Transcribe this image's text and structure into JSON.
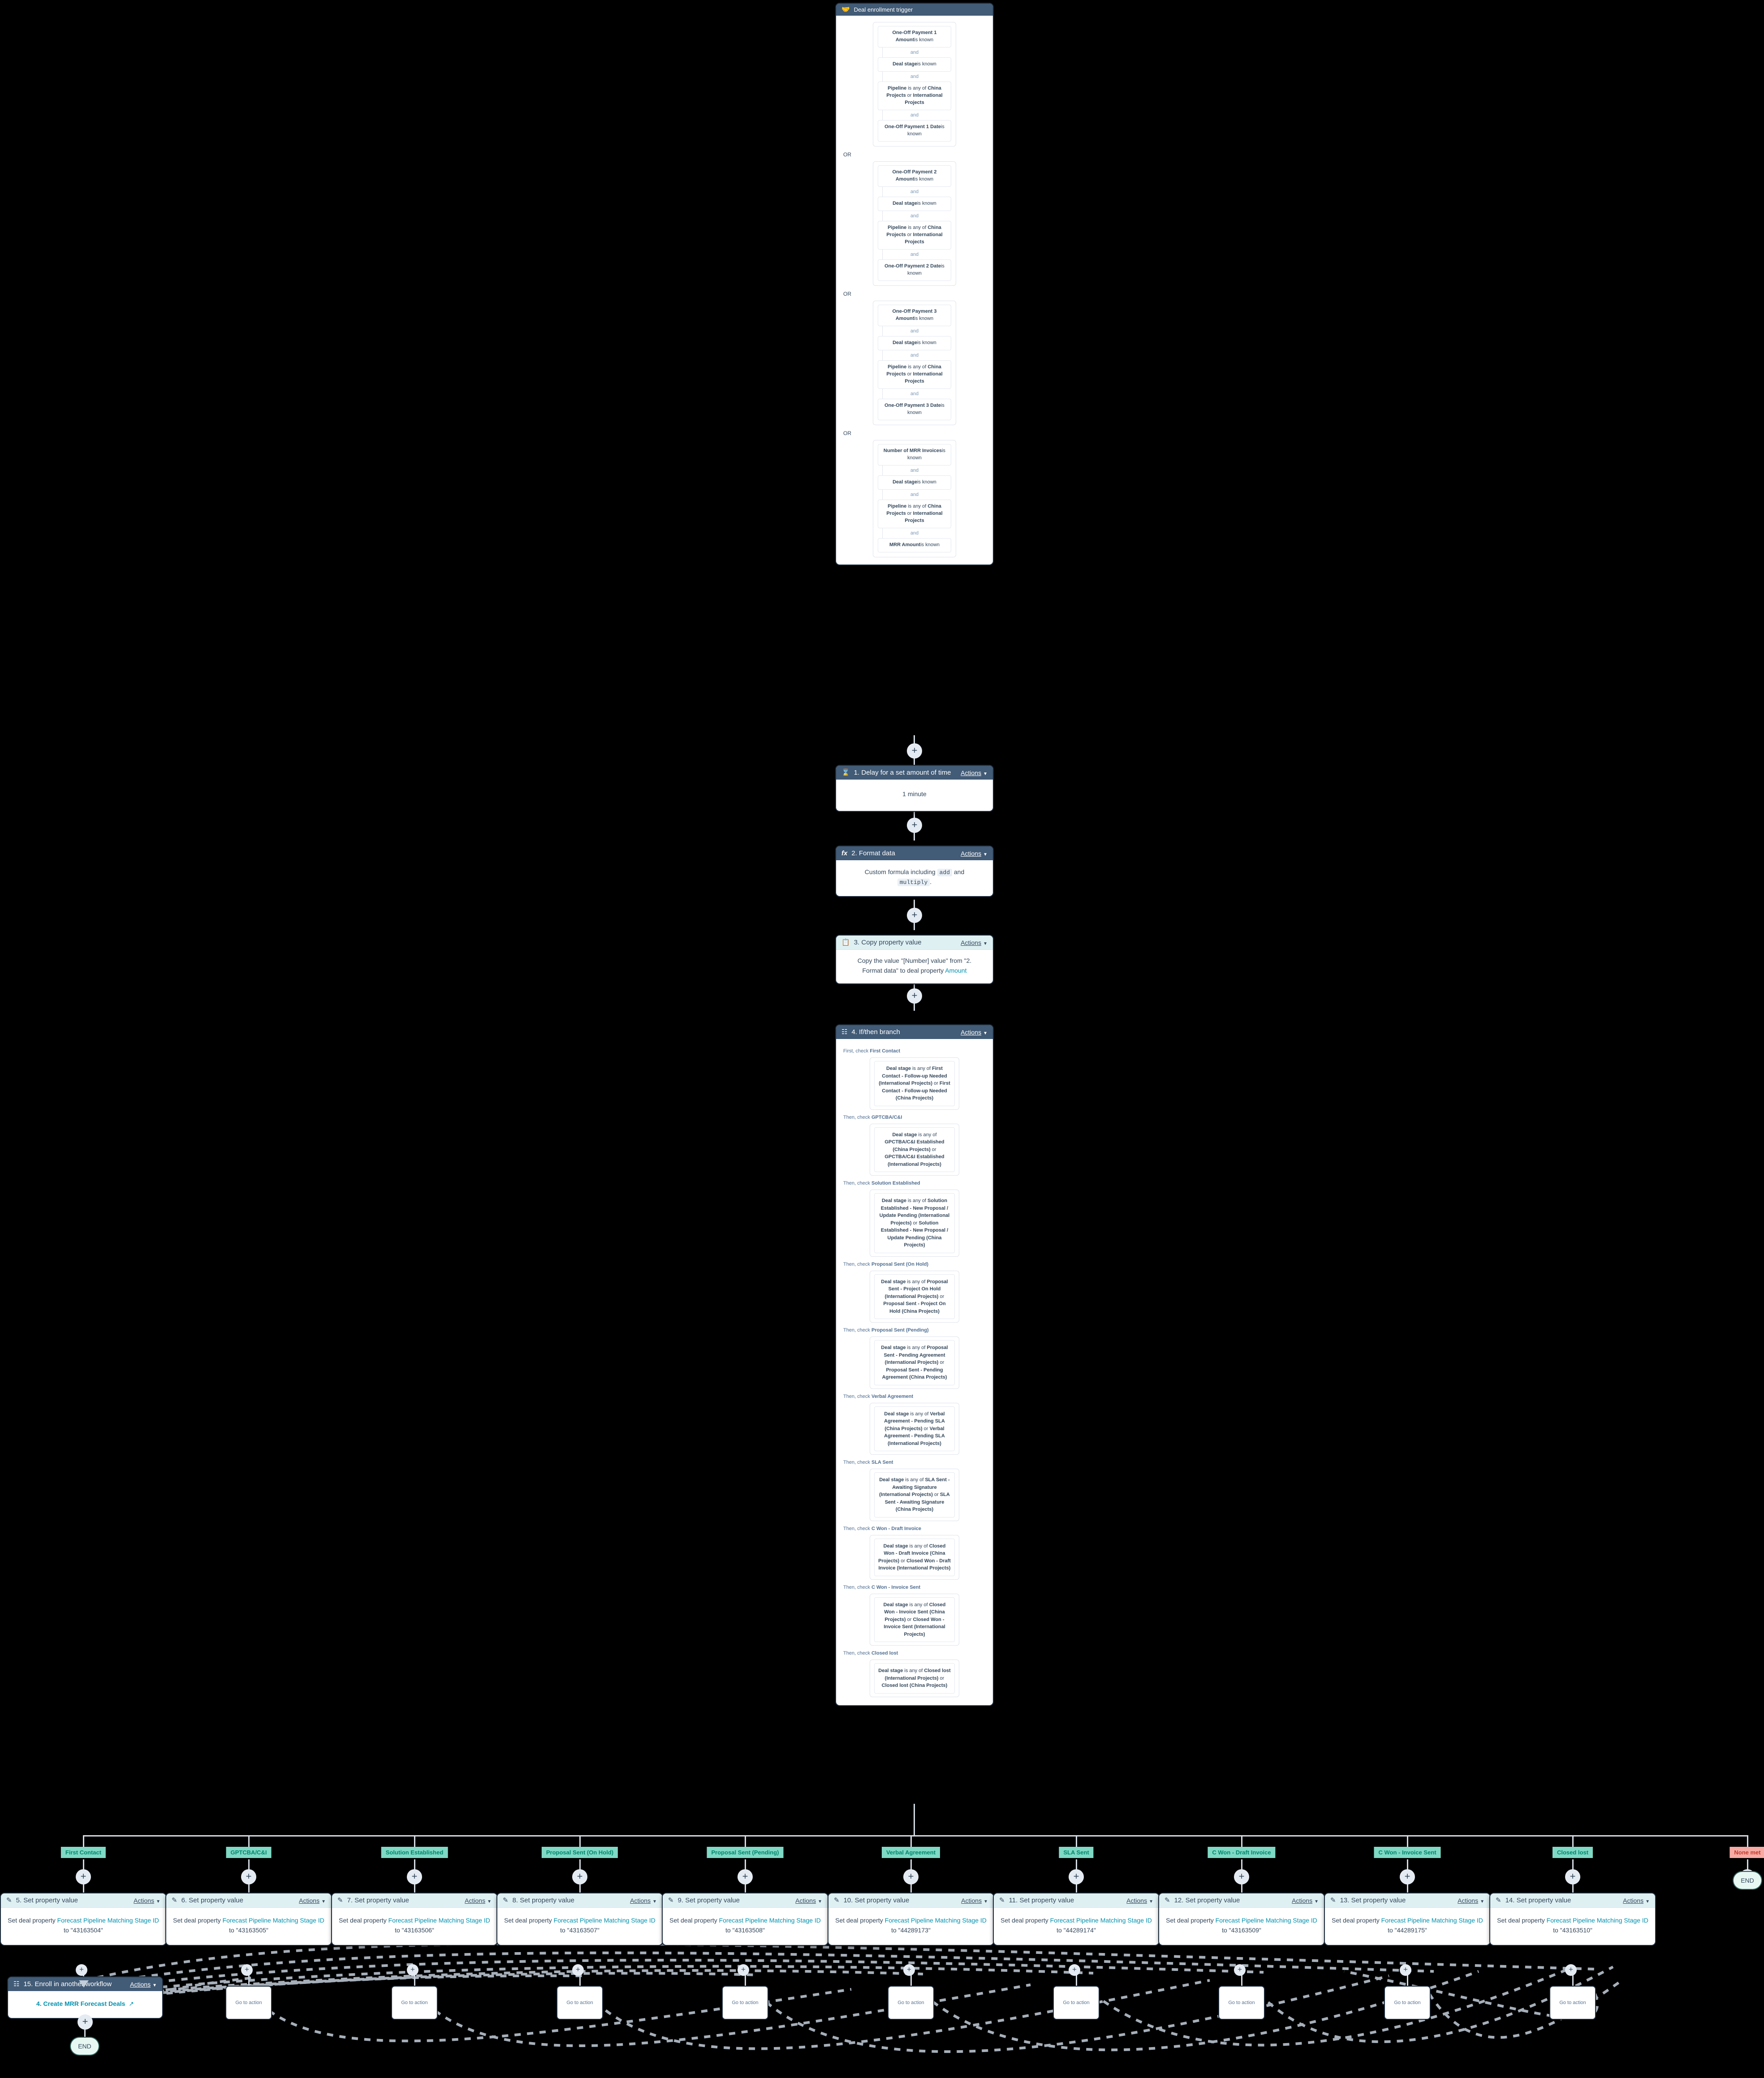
{
  "trigger": {
    "title": "Deal enrollment trigger",
    "icon": "handshake-icon",
    "groups": [
      {
        "rows": [
          "One-Off Payment 1 Amount|is known",
          "Deal stage|is known",
          "Pipeline| is any of |China Projects| or |International Projects",
          "One-Off Payment 1 Date|is known"
        ],
        "and_label": "and"
      },
      {
        "rows": [
          "One-Off Payment 2 Amount|is known",
          "Deal stage|is known",
          "Pipeline| is any of |China Projects| or |International Projects",
          "One-Off Payment 2 Date|is known"
        ],
        "and_label": "and"
      },
      {
        "rows": [
          "One-Off Payment 3 Amount|is known",
          "Deal stage|is known",
          "Pipeline| is any of |China Projects| or |International Projects",
          "One-Off Payment 3 Date|is known"
        ],
        "and_label": "and"
      },
      {
        "rows": [
          "Number of MRR Invoices|is known",
          "Deal stage|is known",
          "Pipeline| is any of |China Projects| or |International Projects",
          "MRR Amount|is known"
        ],
        "and_label": "and"
      }
    ],
    "or_label": "OR"
  },
  "steps": {
    "delay": {
      "number": "1.",
      "title": "1. Delay for a set amount of time",
      "icon": "hourglass-icon",
      "actions_label": "Actions",
      "body": "1 minute"
    },
    "format": {
      "title": "2. Format data",
      "icon": "formula-icon",
      "actions_label": "Actions",
      "body_pre": "Custom formula including ",
      "token1": "add",
      "body_mid": " and ",
      "token2": "multiply",
      "body_post": "."
    },
    "copy": {
      "title": "3. Copy property value",
      "icon": "copy-icon",
      "actions_label": "Actions",
      "body_pre": "Copy the value \"[Number] value\" from \"2. Format data\" to deal property ",
      "property": "Amount"
    },
    "branch": {
      "title": "4. If/then branch",
      "icon": "branch-icon",
      "actions_label": "Actions",
      "conditions": [
        {
          "prefix": "First, check ",
          "name": "First Contact",
          "cond_pre": "Deal stage",
          "cond_mid": " is any of ",
          "cond_a": "First Contact - Follow-up Needed (International Projects)",
          "cond_or": " or ",
          "cond_b": "First Contact - Follow-up Needed (China Projects)"
        },
        {
          "prefix": "Then, check ",
          "name": "GPTCBA/C&I",
          "cond_pre": "Deal stage",
          "cond_mid": " is any of ",
          "cond_a": "GPCTBA/C&I Established (China Projects)",
          "cond_or": " or ",
          "cond_b": "GPCTBA/C&I Established (International Projects)"
        },
        {
          "prefix": "Then, check ",
          "name": "Solution Established",
          "cond_pre": "Deal stage",
          "cond_mid": " is any of ",
          "cond_a": "Solution Established - New Proposal / Update Pending (International Projects)",
          "cond_or": " or ",
          "cond_b": "Solution Established - New Proposal / Update Pending (China Projects)"
        },
        {
          "prefix": "Then, check ",
          "name": "Proposal Sent (On Hold)",
          "cond_pre": "Deal stage",
          "cond_mid": " is any of ",
          "cond_a": "Proposal Sent - Project On Hold (International Projects)",
          "cond_or": " or ",
          "cond_b": "Proposal Sent - Project On Hold (China Projects)"
        },
        {
          "prefix": "Then, check ",
          "name": "Proposal Sent (Pending)",
          "cond_pre": "Deal stage",
          "cond_mid": " is any of ",
          "cond_a": "Proposal Sent - Pending Agreement (International Projects)",
          "cond_or": " or ",
          "cond_b": "Proposal Sent - Pending Agreement (China Projects)"
        },
        {
          "prefix": "Then, check ",
          "name": "Verbal Agreement",
          "cond_pre": "Deal stage",
          "cond_mid": " is any of ",
          "cond_a": "Verbal Agreement - Pending SLA (China Projects)",
          "cond_or": " or ",
          "cond_b": "Verbal Agreement - Pending SLA (International Projects)"
        },
        {
          "prefix": "Then, check ",
          "name": "SLA Sent",
          "cond_pre": "Deal stage",
          "cond_mid": " is any of ",
          "cond_a": "SLA Sent - Awaiting Signature (International Projects)",
          "cond_or": " or ",
          "cond_b": "SLA Sent - Awaiting Signature (China Projects)"
        },
        {
          "prefix": "Then, check ",
          "name": "C Won - Draft Invoice",
          "cond_pre": "Deal stage",
          "cond_mid": " is any of ",
          "cond_a": "Closed Won - Draft Invoice (China Projects)",
          "cond_or": " or ",
          "cond_b": "Closed Won - Draft Invoice (International Projects)"
        },
        {
          "prefix": "Then, check ",
          "name": "C Won - Invoice Sent",
          "cond_pre": "Deal stage",
          "cond_mid": " is any of ",
          "cond_a": "Closed Won - Invoice Sent (China Projects)",
          "cond_or": " or ",
          "cond_b": "Closed Won - Invoice Sent (International Projects)"
        },
        {
          "prefix": "Then, check ",
          "name": "Closed lost",
          "cond_pre": "Deal stage",
          "cond_mid": " is any of ",
          "cond_a": "Closed lost (International Projects)",
          "cond_or": " or ",
          "cond_b": "Closed lost (China Projects)"
        }
      ]
    },
    "enroll": {
      "title": "15. Enroll in another workflow",
      "icon": "workflow-icon",
      "actions_label": "Actions",
      "link": "4. Create MRR Forecast Deals",
      "external_icon": "external-link-icon"
    }
  },
  "branches": [
    {
      "chip": "First Contact",
      "card_title": "5. Set property value",
      "icon": "pencil-square-icon",
      "actions_label": "Actions",
      "body_pre": "Set deal property ",
      "property": "Forecast Pipeline Matching Stage ID",
      "body_mid": " to ",
      "value": "\"43163504\""
    },
    {
      "chip": "GPTCBA/C&I",
      "card_title": "6. Set property value",
      "icon": "pencil-square-icon",
      "actions_label": "Actions",
      "body_pre": "Set deal property ",
      "property": "Forecast Pipeline Matching Stage ID",
      "body_mid": " to ",
      "value": "\"43163505\""
    },
    {
      "chip": "Solution Established",
      "card_title": "7. Set property value",
      "icon": "pencil-square-icon",
      "actions_label": "Actions",
      "body_pre": "Set deal property ",
      "property": "Forecast Pipeline Matching Stage ID",
      "body_mid": " to ",
      "value": "\"43163506\""
    },
    {
      "chip": "Proposal Sent (On Hold)",
      "card_title": "8. Set property value",
      "icon": "pencil-square-icon",
      "actions_label": "Actions",
      "body_pre": "Set deal property ",
      "property": "Forecast Pipeline Matching Stage ID",
      "body_mid": " to ",
      "value": "\"43163507\""
    },
    {
      "chip": "Proposal Sent (Pending)",
      "card_title": "9. Set property value",
      "icon": "pencil-square-icon",
      "actions_label": "Actions",
      "body_pre": "Set deal property ",
      "property": "Forecast Pipeline Matching Stage ID",
      "body_mid": " to ",
      "value": "\"43163508\""
    },
    {
      "chip": "Verbal Agreement",
      "card_title": "10. Set property value",
      "icon": "pencil-square-icon",
      "actions_label": "Actions",
      "body_pre": "Set deal property ",
      "property": "Forecast Pipeline Matching Stage ID",
      "body_mid": " to ",
      "value": "\"44289173\""
    },
    {
      "chip": "SLA Sent",
      "card_title": "11. Set property value",
      "icon": "pencil-square-icon",
      "actions_label": "Actions",
      "body_pre": "Set deal property ",
      "property": "Forecast Pipeline Matching Stage ID",
      "body_mid": " to ",
      "value": "\"44289174\""
    },
    {
      "chip": "C Won - Draft Invoice",
      "card_title": "12. Set property value",
      "icon": "pencil-square-icon",
      "actions_label": "Actions",
      "body_pre": "Set deal property ",
      "property": "Forecast Pipeline Matching Stage ID",
      "body_mid": " to ",
      "value": "\"43163509\""
    },
    {
      "chip": "C Won - Invoice Sent",
      "card_title": "13. Set property value",
      "icon": "pencil-square-icon",
      "actions_label": "Actions",
      "body_pre": "Set deal property ",
      "property": "Forecast Pipeline Matching Stage ID",
      "body_mid": " to ",
      "value": "\"44289175\""
    },
    {
      "chip": "Closed lost",
      "card_title": "14. Set property value",
      "icon": "pencil-square-icon",
      "actions_label": "Actions",
      "body_pre": "Set deal property ",
      "property": "Forecast Pipeline Matching Stage ID",
      "body_mid": " to ",
      "value": "\"43163510\""
    }
  ],
  "none_met": {
    "chip": "None met",
    "end_label": "END"
  },
  "goto_label": "Go to action",
  "end_label": "END",
  "colors": {
    "card_header_dark": "#425b76",
    "card_header_light": "#dff0f3",
    "chip_green": "#7fd9c5",
    "chip_green_text": "#00856b",
    "chip_red": "#f7aaa4",
    "chip_red_text": "#c0392b",
    "link_teal": "#0091ae",
    "canvas": "#000000",
    "connector": "#d5dce3"
  }
}
